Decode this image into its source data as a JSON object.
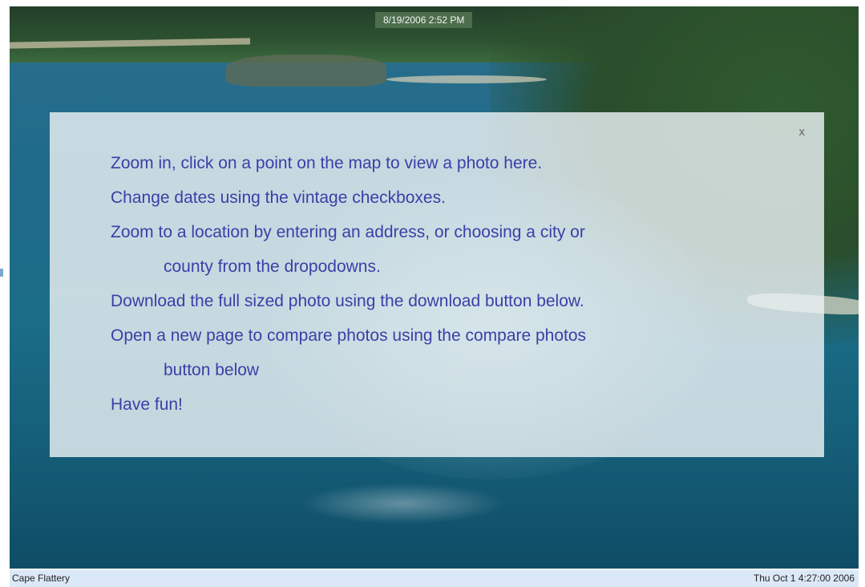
{
  "photo": {
    "date_overlay": "8/19/2006 2:52 PM"
  },
  "info_panel": {
    "close_label": "x",
    "lines": [
      "Zoom in, click on a point on the map to view a photo here.",
      "Change dates using the vintage checkboxes.",
      "Zoom to a location by entering an address, or choosing a city or",
      "county from the dropodowns.",
      "Download the full sized photo using the download button below.",
      "Open a new page to compare photos using the compare photos",
      "button below",
      "Have fun!"
    ]
  },
  "status_bar": {
    "location": "Cape Flattery",
    "timestamp": "Thu Oct 1 4:27:00 2006"
  },
  "colors": {
    "instruction_text": "#3a3fa7",
    "status_bar_bg": "#dbe8f7",
    "date_badge_bg": "#4d6e4c"
  }
}
